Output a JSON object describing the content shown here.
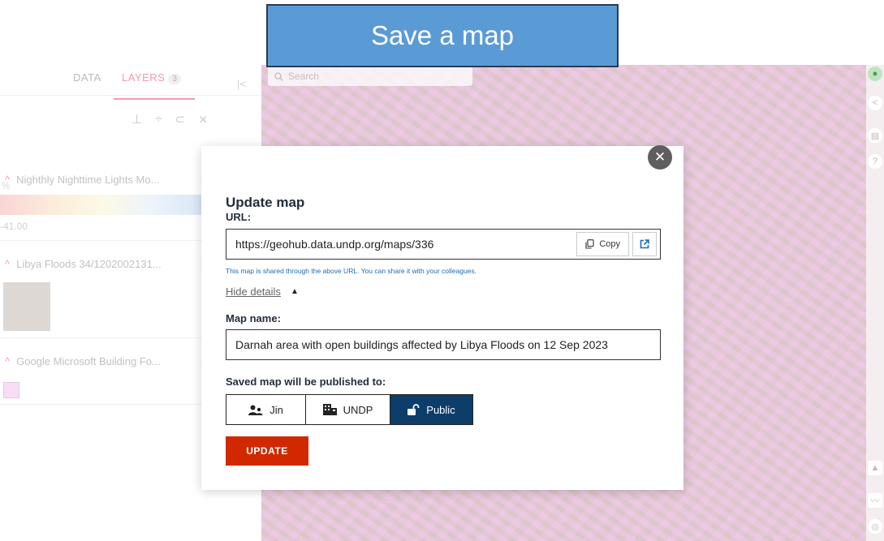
{
  "banner": {
    "title": "Save a map"
  },
  "sidebar": {
    "tabs": [
      {
        "label": "DATA"
      },
      {
        "label": "LAYERS",
        "count": "3"
      }
    ],
    "collapse_icon": "|<",
    "legend_min": "-41.00",
    "legend_unit": "%",
    "layers": [
      {
        "title": "Nighthly Nighttime Lights Mo..."
      },
      {
        "title": "Libya Floods 34/1202002131..."
      },
      {
        "title": "Google Microsoft Building Fo..."
      }
    ]
  },
  "map": {
    "search_placeholder": "Search"
  },
  "modal": {
    "title": "Update map",
    "url_label": "URL:",
    "url_value": "https://geohub.data.undp.org/maps/336",
    "copy_label": "Copy",
    "helper_text": "This map is shared through the above URL. You can share it with your colleagues.",
    "details_toggle": "Hide details",
    "name_label": "Map name:",
    "name_value": "Darnah area with open buildings affected by Libya Floods on 12 Sep 2023",
    "publish_label": "Saved map will be published to:",
    "publish_options": [
      {
        "label": "Jin",
        "icon": "users-icon"
      },
      {
        "label": "UNDP",
        "icon": "building-icon"
      },
      {
        "label": "Public",
        "icon": "unlock-icon"
      }
    ],
    "publish_selected": "Public",
    "update_label": "UPDATE"
  },
  "colors": {
    "accent_red": "#d12800",
    "selected_blue": "#0c3d6b",
    "banner_blue": "#5b9bd5",
    "tab_red": "#e5243b"
  }
}
